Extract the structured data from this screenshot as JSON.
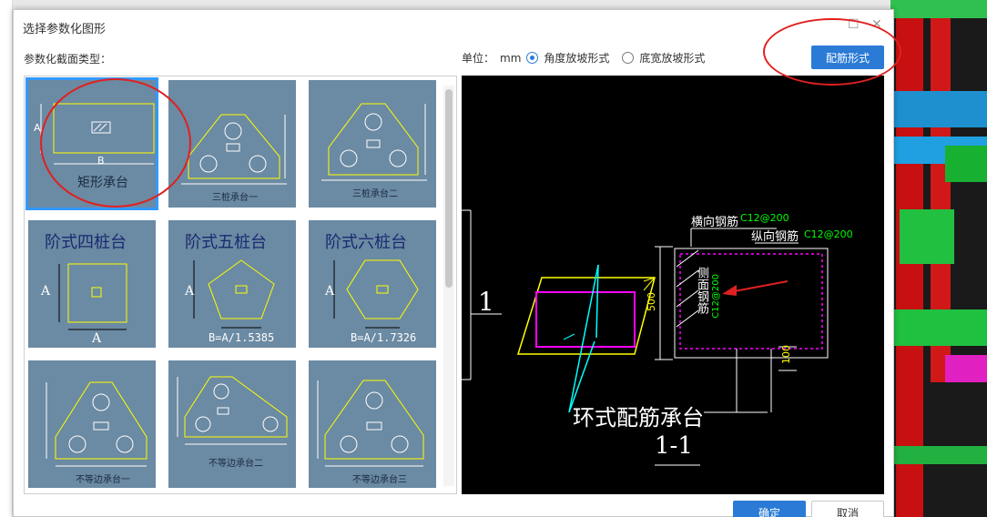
{
  "dialog": {
    "title": "选择参数化图形",
    "section_label": "参数化截面类型：",
    "unit_label": "单位：",
    "unit_value": "mm",
    "slope_options": [
      "角度放坡形式",
      "底宽放坡形式"
    ],
    "selected_slope": 0,
    "rebar_button": "配筋形式",
    "ok_button": "确定",
    "cancel_button": "取消"
  },
  "tiles": [
    {
      "caption": "矩形承台",
      "letter_a": "A",
      "letter_b": "B",
      "selected": true
    },
    {
      "caption": "三桩承台一"
    },
    {
      "caption": "三桩承台二"
    },
    {
      "caption": "阶式四桩台",
      "letter_a": "A",
      "letter_b": "A"
    },
    {
      "caption": "阶式五桩台",
      "letter_a": "A",
      "formula": "B=A/1.5385"
    },
    {
      "caption": "阶式六桩台",
      "letter_a": "A",
      "formula": "B=A/1.7326"
    },
    {
      "caption": "不等边承台一"
    },
    {
      "caption": "不等边承台二"
    },
    {
      "caption": "不等边承台三"
    }
  ],
  "preview": {
    "title": "环式配筋承台",
    "section_mark": "1-1",
    "section_no": "1",
    "horizontal_rebar_label": "横向钢筋",
    "horizontal_rebar_value": "C12@200",
    "longitudinal_rebar_label": "纵向钢筋",
    "longitudinal_rebar_value": "C12@200",
    "side_rebar_label": "侧面钢筋",
    "side_rebar_value": "C12@200",
    "dim_height": "500",
    "dim_bottom": "100"
  },
  "colors": {
    "accent": "#2b7bd6",
    "tile_bg": "#6b8aa3",
    "annotation_red": "#e02020",
    "cad_yellow": "#ffff00",
    "cad_magenta": "#ff00ff",
    "cad_cyan": "#00ffff",
    "cad_green": "#00ff00"
  }
}
